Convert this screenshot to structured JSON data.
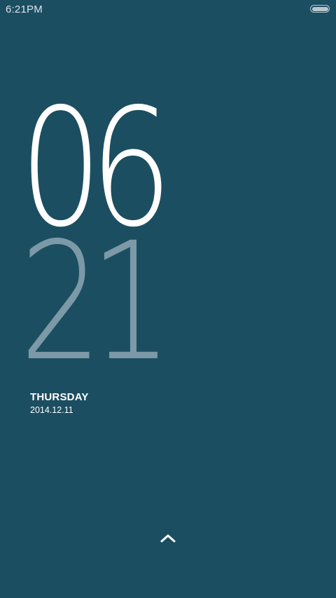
{
  "status_bar": {
    "time": "6:21PM",
    "battery_icon": "battery-icon"
  },
  "lockscreen": {
    "hours": "06",
    "minutes": "21",
    "weekday": "THURSDAY",
    "date": "2014.12.11",
    "unlock_icon": "chevron-up-icon"
  },
  "colors": {
    "background": "#1c4e61",
    "hours": "#ffffff",
    "minutes": "#7b99a6"
  }
}
